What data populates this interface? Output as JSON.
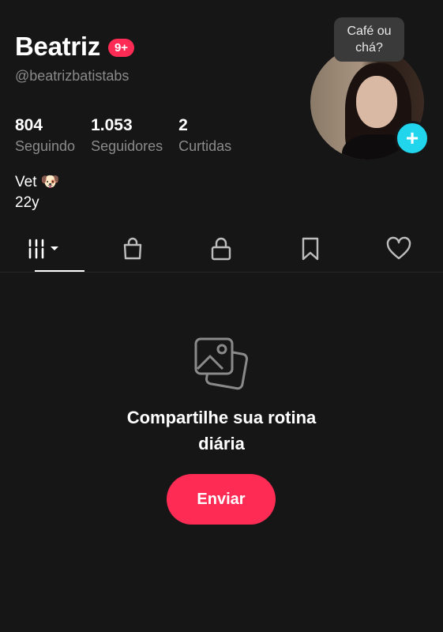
{
  "profile": {
    "name": "Beatriz",
    "badge": "9+",
    "handle": "@beatrizbatistabs",
    "bio_line1": "Vet 🐶",
    "bio_line2": "22y",
    "bubble_line1": "Café ou",
    "bubble_line2": "chá?"
  },
  "stats": [
    {
      "value": "804",
      "label": "Seguindo"
    },
    {
      "value": "1.053",
      "label": "Seguidores"
    },
    {
      "value": "2",
      "label": "Curtidas"
    }
  ],
  "tabs": [
    {
      "icon": "grid-icon",
      "active": true
    },
    {
      "icon": "shopping-bag-icon",
      "active": false
    },
    {
      "icon": "lock-icon",
      "active": false
    },
    {
      "icon": "bookmark-icon",
      "active": false
    },
    {
      "icon": "heart-icon",
      "active": false
    }
  ],
  "empty_state": {
    "icon": "photos-icon",
    "title_line1": "Compartilhe sua rotina",
    "title_line2": "diária",
    "button_label": "Enviar"
  },
  "colors": {
    "background": "#161616",
    "accent": "#fe2c55",
    "add_button": "#20d5ec",
    "secondary_text": "#8a8a8a"
  }
}
